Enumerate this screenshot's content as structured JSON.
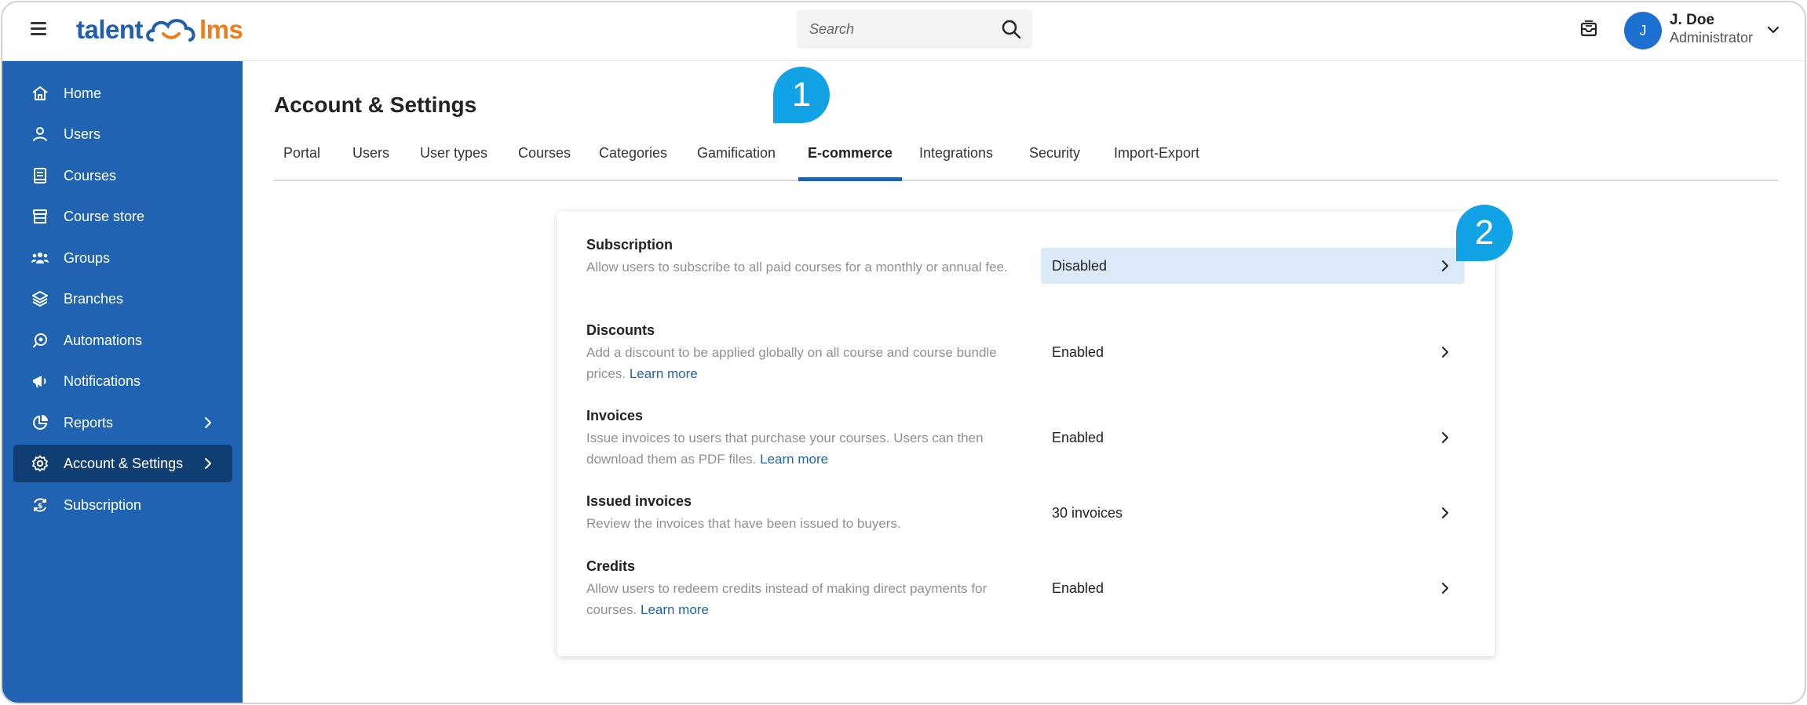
{
  "header": {
    "logo_left": "talent",
    "logo_right": "lms",
    "search_placeholder": "Search",
    "user": {
      "initial": "J",
      "name": "J. Doe",
      "role": "Administrator"
    }
  },
  "sidebar": {
    "items": [
      {
        "label": "Home",
        "icon": "home-icon"
      },
      {
        "label": "Users",
        "icon": "user-icon"
      },
      {
        "label": "Courses",
        "icon": "book-icon"
      },
      {
        "label": "Course store",
        "icon": "store-icon"
      },
      {
        "label": "Groups",
        "icon": "groups-icon"
      },
      {
        "label": "Branches",
        "icon": "layers-icon"
      },
      {
        "label": "Automations",
        "icon": "automation-icon"
      },
      {
        "label": "Notifications",
        "icon": "megaphone-icon"
      },
      {
        "label": "Reports",
        "icon": "pie-chart-icon",
        "has_children": true
      },
      {
        "label": "Account & Settings",
        "icon": "gear-icon",
        "has_children": true,
        "active": true
      },
      {
        "label": "Subscription",
        "icon": "subscription-icon"
      }
    ]
  },
  "main": {
    "title": "Account & Settings",
    "tabs": [
      "Portal",
      "Users",
      "User types",
      "Courses",
      "Categories",
      "Gamification",
      "E-commerce",
      "Integrations",
      "Security",
      "Import-Export"
    ],
    "active_tab": "E-commerce",
    "settings": [
      {
        "title": "Subscription",
        "desc": "Allow users to subscribe to all paid courses for a monthly or annual fee.",
        "link": "",
        "value": "Disabled",
        "highlighted": true
      },
      {
        "title": "Discounts",
        "desc": "Add a discount to be applied globally on all course and course bundle prices.",
        "link": "Learn more",
        "value": "Enabled"
      },
      {
        "title": "Invoices",
        "desc": "Issue invoices to users that purchase your courses. Users can then download them as PDF files.",
        "link": "Learn more",
        "value": "Enabled"
      },
      {
        "title": "Issued invoices",
        "desc": "Review the invoices that have been issued to buyers.",
        "link": "",
        "value": "30 invoices"
      },
      {
        "title": "Credits",
        "desc": "Allow users to redeem credits instead of making direct payments for courses.",
        "link": "Learn more",
        "value": "Enabled"
      }
    ]
  },
  "callouts": [
    "1",
    "2"
  ],
  "colors": {
    "sidebar": "#1f63b2",
    "sidebar_active": "#113e72",
    "callout": "#12a3e6",
    "highlight": "#dbe9f8",
    "logo_orange": "#ef7d1a"
  }
}
